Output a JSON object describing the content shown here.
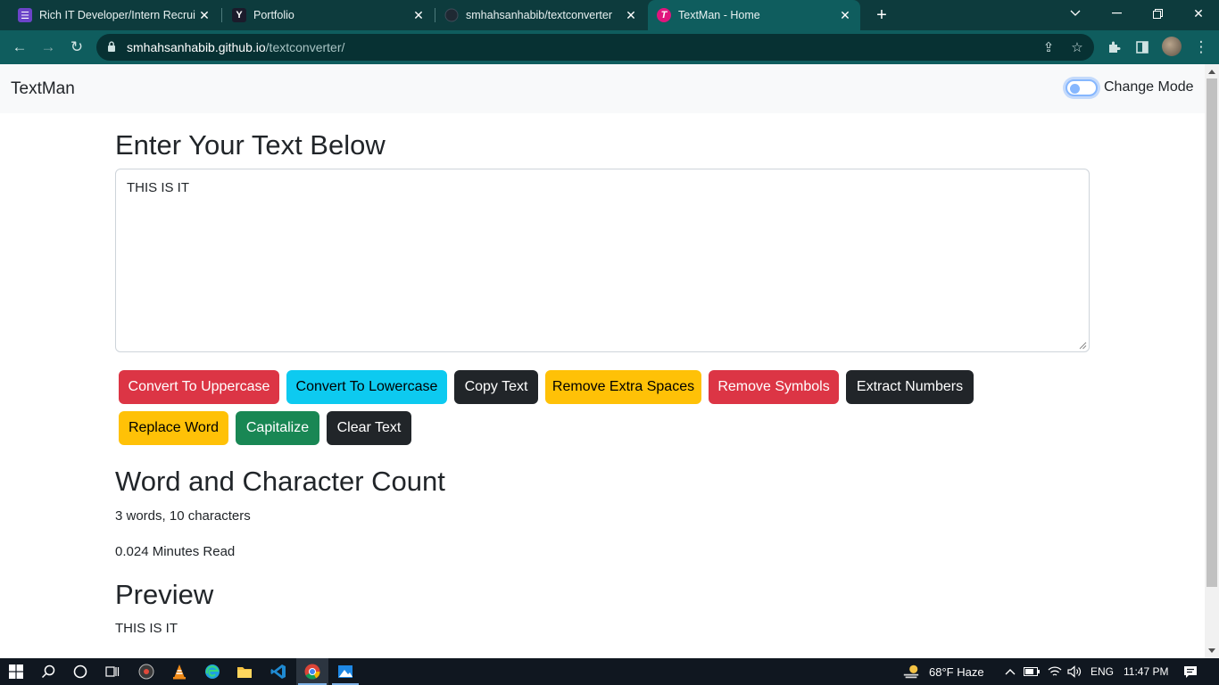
{
  "browser": {
    "tabs": [
      {
        "title": "Rich IT Developer/Intern Recruitm",
        "favicon": "form-icon",
        "favicon_color": "#6b44c9",
        "active": false
      },
      {
        "title": "Portfolio",
        "favicon": "y-icon",
        "favicon_color": "#1b1b2b",
        "active": false
      },
      {
        "title": "smhahsanhabib/textconverter",
        "favicon": "github-icon",
        "favicon_color": "#1f2933",
        "active": false
      },
      {
        "title": "TextMan - Home",
        "favicon": "t-icon",
        "favicon_color": "#e0157d",
        "active": true
      }
    ],
    "url_host": "smhahsanhabib.github.io",
    "url_path": "/textconverter/",
    "chrome_color": "#0f5d5e"
  },
  "navbar": {
    "brand": "TextMan",
    "mode_label": "Change Mode"
  },
  "main": {
    "heading": "Enter Your Text Below",
    "textarea_value": "THIS IS IT",
    "buttons": [
      {
        "label": "Convert To Uppercase",
        "style": "danger"
      },
      {
        "label": "Convert To Lowercase",
        "style": "info"
      },
      {
        "label": "Copy Text",
        "style": "dark"
      },
      {
        "label": "Remove Extra Spaces",
        "style": "warning"
      },
      {
        "label": "Remove Symbols",
        "style": "danger"
      },
      {
        "label": "Extract Numbers",
        "style": "dark"
      },
      {
        "label": "Replace Word",
        "style": "warning"
      },
      {
        "label": "Capitalize",
        "style": "success"
      },
      {
        "label": "Clear Text",
        "style": "dark"
      }
    ]
  },
  "summary": {
    "heading": "Word and Character Count",
    "counts": "3 words, 10 characters",
    "read_time": "0.024 Minutes Read"
  },
  "preview": {
    "heading": "Preview",
    "text": "THIS IS IT"
  },
  "taskbar": {
    "weather": "68°F  Haze",
    "language": "ENG",
    "time": "11:47 PM"
  }
}
